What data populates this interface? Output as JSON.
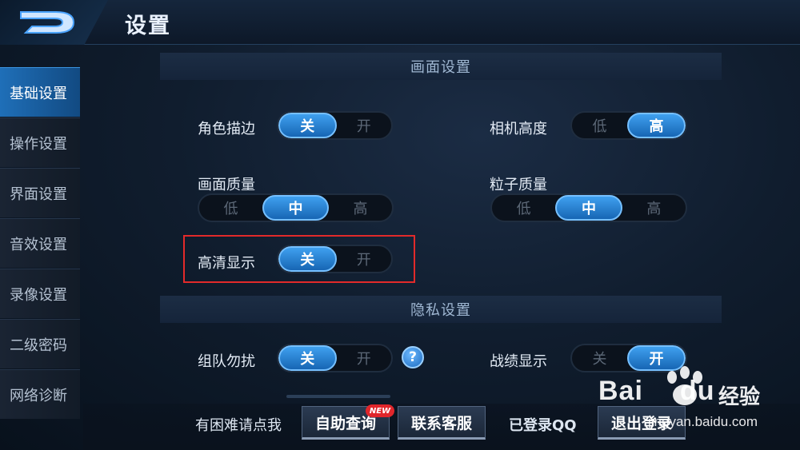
{
  "header": {
    "title": "设置"
  },
  "sidebar": {
    "items": [
      {
        "label": "基础设置",
        "active": true
      },
      {
        "label": "操作设置",
        "active": false
      },
      {
        "label": "界面设置",
        "active": false
      },
      {
        "label": "音效设置",
        "active": false
      },
      {
        "label": "录像设置",
        "active": false
      },
      {
        "label": "二级密码",
        "active": false
      },
      {
        "label": "网络诊断",
        "active": false
      }
    ]
  },
  "sections": {
    "display": {
      "title": "画面设置",
      "role_outline": {
        "label": "角色描边",
        "options": [
          "关",
          "开"
        ],
        "selected": "关"
      },
      "camera_height": {
        "label": "相机高度",
        "options": [
          "低",
          "高"
        ],
        "selected": "高"
      },
      "picture_quality": {
        "label": "画面质量",
        "options": [
          "低",
          "中",
          "高"
        ],
        "selected": "中"
      },
      "particle_quality": {
        "label": "粒子质量",
        "options": [
          "低",
          "中",
          "高"
        ],
        "selected": "中"
      },
      "hd_display": {
        "label": "高清显示",
        "options": [
          "关",
          "开"
        ],
        "selected": "关"
      }
    },
    "privacy": {
      "title": "隐私设置",
      "team_dnd": {
        "label": "组队勿扰",
        "options": [
          "关",
          "开"
        ],
        "selected": "关"
      },
      "record_display": {
        "label": "战绩显示",
        "options": [
          "关",
          "开"
        ],
        "selected": "开"
      }
    }
  },
  "bottom": {
    "help_text": "有困难请点我",
    "self_query_label": "自助查询",
    "new_badge": "NEW",
    "contact_label": "联系客服",
    "login_status": "已登录QQ",
    "logout_label": "退出登录"
  },
  "watermark": {
    "brand": "Bai",
    "brand_suffix": "du",
    "cn": "经验",
    "url": "jingyan.baidu.com"
  },
  "colors": {
    "accent": "#1f6fb8",
    "toggle_selected": "#2a86d6",
    "highlight_box": "#e22a2a",
    "badge": "#e0262b"
  },
  "icons": {
    "back": "back-d-icon",
    "help": "question-mark-icon",
    "watermark": "baidu-paw-icon"
  }
}
